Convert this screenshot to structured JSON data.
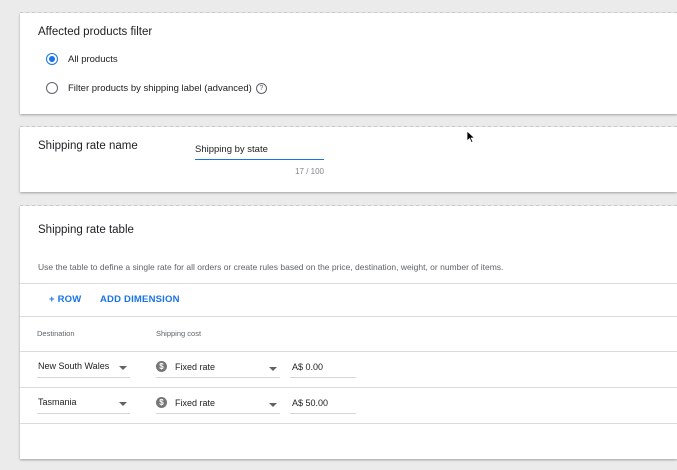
{
  "filter_card": {
    "title": "Affected products filter",
    "options": [
      {
        "label": "All products",
        "checked": true
      },
      {
        "label": "Filter products by shipping label (advanced)",
        "checked": false
      }
    ],
    "help_icon": "help-circle-icon"
  },
  "rate_name_card": {
    "label": "Shipping rate name",
    "value": "Shipping by state",
    "counter": "17 / 100"
  },
  "rate_table_card": {
    "title": "Shipping rate table",
    "description": "Use the table to define a single rate for all orders or create rules based on the price, destination, weight, or number of items.",
    "add_row_label": "+ ROW",
    "add_dimension_label": "ADD DIMENSION",
    "columns": [
      "Destination",
      "Shipping cost"
    ],
    "rows": [
      {
        "destination": "New South Wales",
        "cost_type": "Fixed rate",
        "amount": "A$ 0.00"
      },
      {
        "destination": "Tasmania",
        "cost_type": "Fixed rate",
        "amount": "A$ 50.00"
      }
    ]
  },
  "colors": {
    "accent": "#1a73e8",
    "background": "#ebebeb",
    "card": "#ffffff"
  },
  "icons": {
    "currency": "dollar-circle-icon",
    "dropdown": "chevron-down-icon",
    "pointer": "mouse-cursor-icon"
  }
}
